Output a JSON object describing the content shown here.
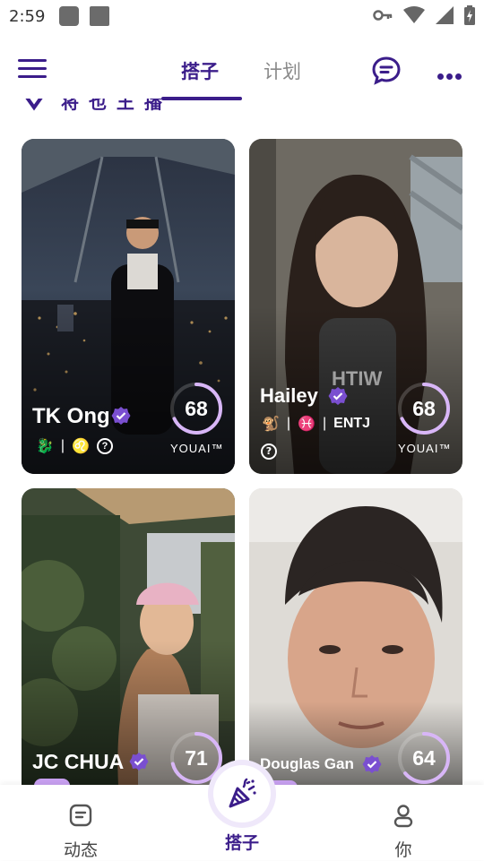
{
  "status_bar": {
    "time": "2:59"
  },
  "top_nav": {
    "tabs": [
      {
        "label": "搭子",
        "active": true
      },
      {
        "label": "计划",
        "active": false
      }
    ]
  },
  "section_peek": {
    "text": "将 也 王 播"
  },
  "cards": [
    {
      "name": "TK Ong",
      "score": "68",
      "score_fraction": 0.68,
      "brand": "YOUAI™",
      "traits": [
        "🐉",
        "|",
        "♌"
      ],
      "verified": true
    },
    {
      "name": "Hailey",
      "score": "68",
      "score_fraction": 0.68,
      "brand": "YOUAI™",
      "traits": [
        "🐒",
        "|",
        "♓",
        "|",
        "ENTJ"
      ],
      "verified": true
    },
    {
      "name": "JC CHUA",
      "score": "71",
      "score_fraction": 0.71,
      "verified": true
    },
    {
      "name": "Douglas Gan",
      "score": "64",
      "score_fraction": 0.64,
      "verified": true
    }
  ],
  "bottom_nav": {
    "items": [
      {
        "label": "动态",
        "icon": "feed-icon"
      },
      {
        "label": "搭子",
        "icon": "party-popper-icon",
        "active": true
      },
      {
        "label": "你",
        "icon": "person-icon"
      }
    ]
  },
  "colors": {
    "brand": "#3b1d8a",
    "ring": "#d8b6f7",
    "verify": "#7a4fd0"
  }
}
